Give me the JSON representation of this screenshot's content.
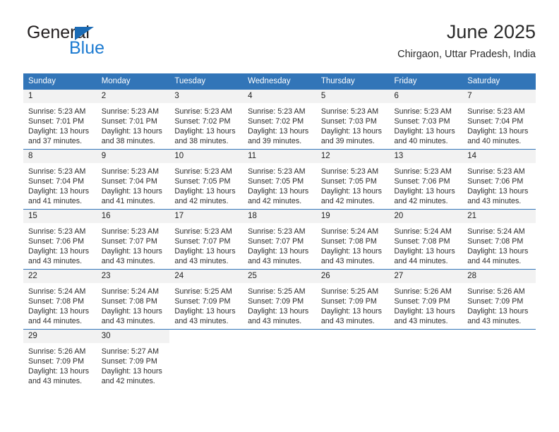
{
  "brand": {
    "name_top": "General",
    "name_bottom": "Blue",
    "accent_color": "#1b7ad1",
    "triangle_color": "#1b6bb5"
  },
  "header": {
    "title": "June 2025",
    "subtitle": "Chirgaon, Uttar Pradesh, India"
  },
  "theme": {
    "header_blue": "#3275b8",
    "daynum_bg": "#f2f2f2",
    "text": "#2b2b2b"
  },
  "weekdays": [
    "Sunday",
    "Monday",
    "Tuesday",
    "Wednesday",
    "Thursday",
    "Friday",
    "Saturday"
  ],
  "days": [
    {
      "num": "1",
      "sunrise": "Sunrise: 5:23 AM",
      "sunset": "Sunset: 7:01 PM",
      "daylight1": "Daylight: 13 hours",
      "daylight2": "and 37 minutes."
    },
    {
      "num": "2",
      "sunrise": "Sunrise: 5:23 AM",
      "sunset": "Sunset: 7:01 PM",
      "daylight1": "Daylight: 13 hours",
      "daylight2": "and 38 minutes."
    },
    {
      "num": "3",
      "sunrise": "Sunrise: 5:23 AM",
      "sunset": "Sunset: 7:02 PM",
      "daylight1": "Daylight: 13 hours",
      "daylight2": "and 38 minutes."
    },
    {
      "num": "4",
      "sunrise": "Sunrise: 5:23 AM",
      "sunset": "Sunset: 7:02 PM",
      "daylight1": "Daylight: 13 hours",
      "daylight2": "and 39 minutes."
    },
    {
      "num": "5",
      "sunrise": "Sunrise: 5:23 AM",
      "sunset": "Sunset: 7:03 PM",
      "daylight1": "Daylight: 13 hours",
      "daylight2": "and 39 minutes."
    },
    {
      "num": "6",
      "sunrise": "Sunrise: 5:23 AM",
      "sunset": "Sunset: 7:03 PM",
      "daylight1": "Daylight: 13 hours",
      "daylight2": "and 40 minutes."
    },
    {
      "num": "7",
      "sunrise": "Sunrise: 5:23 AM",
      "sunset": "Sunset: 7:04 PM",
      "daylight1": "Daylight: 13 hours",
      "daylight2": "and 40 minutes."
    },
    {
      "num": "8",
      "sunrise": "Sunrise: 5:23 AM",
      "sunset": "Sunset: 7:04 PM",
      "daylight1": "Daylight: 13 hours",
      "daylight2": "and 41 minutes."
    },
    {
      "num": "9",
      "sunrise": "Sunrise: 5:23 AM",
      "sunset": "Sunset: 7:04 PM",
      "daylight1": "Daylight: 13 hours",
      "daylight2": "and 41 minutes."
    },
    {
      "num": "10",
      "sunrise": "Sunrise: 5:23 AM",
      "sunset": "Sunset: 7:05 PM",
      "daylight1": "Daylight: 13 hours",
      "daylight2": "and 42 minutes."
    },
    {
      "num": "11",
      "sunrise": "Sunrise: 5:23 AM",
      "sunset": "Sunset: 7:05 PM",
      "daylight1": "Daylight: 13 hours",
      "daylight2": "and 42 minutes."
    },
    {
      "num": "12",
      "sunrise": "Sunrise: 5:23 AM",
      "sunset": "Sunset: 7:05 PM",
      "daylight1": "Daylight: 13 hours",
      "daylight2": "and 42 minutes."
    },
    {
      "num": "13",
      "sunrise": "Sunrise: 5:23 AM",
      "sunset": "Sunset: 7:06 PM",
      "daylight1": "Daylight: 13 hours",
      "daylight2": "and 42 minutes."
    },
    {
      "num": "14",
      "sunrise": "Sunrise: 5:23 AM",
      "sunset": "Sunset: 7:06 PM",
      "daylight1": "Daylight: 13 hours",
      "daylight2": "and 43 minutes."
    },
    {
      "num": "15",
      "sunrise": "Sunrise: 5:23 AM",
      "sunset": "Sunset: 7:06 PM",
      "daylight1": "Daylight: 13 hours",
      "daylight2": "and 43 minutes."
    },
    {
      "num": "16",
      "sunrise": "Sunrise: 5:23 AM",
      "sunset": "Sunset: 7:07 PM",
      "daylight1": "Daylight: 13 hours",
      "daylight2": "and 43 minutes."
    },
    {
      "num": "17",
      "sunrise": "Sunrise: 5:23 AM",
      "sunset": "Sunset: 7:07 PM",
      "daylight1": "Daylight: 13 hours",
      "daylight2": "and 43 minutes."
    },
    {
      "num": "18",
      "sunrise": "Sunrise: 5:23 AM",
      "sunset": "Sunset: 7:07 PM",
      "daylight1": "Daylight: 13 hours",
      "daylight2": "and 43 minutes."
    },
    {
      "num": "19",
      "sunrise": "Sunrise: 5:24 AM",
      "sunset": "Sunset: 7:08 PM",
      "daylight1": "Daylight: 13 hours",
      "daylight2": "and 43 minutes."
    },
    {
      "num": "20",
      "sunrise": "Sunrise: 5:24 AM",
      "sunset": "Sunset: 7:08 PM",
      "daylight1": "Daylight: 13 hours",
      "daylight2": "and 44 minutes."
    },
    {
      "num": "21",
      "sunrise": "Sunrise: 5:24 AM",
      "sunset": "Sunset: 7:08 PM",
      "daylight1": "Daylight: 13 hours",
      "daylight2": "and 44 minutes."
    },
    {
      "num": "22",
      "sunrise": "Sunrise: 5:24 AM",
      "sunset": "Sunset: 7:08 PM",
      "daylight1": "Daylight: 13 hours",
      "daylight2": "and 44 minutes."
    },
    {
      "num": "23",
      "sunrise": "Sunrise: 5:24 AM",
      "sunset": "Sunset: 7:08 PM",
      "daylight1": "Daylight: 13 hours",
      "daylight2": "and 43 minutes."
    },
    {
      "num": "24",
      "sunrise": "Sunrise: 5:25 AM",
      "sunset": "Sunset: 7:09 PM",
      "daylight1": "Daylight: 13 hours",
      "daylight2": "and 43 minutes."
    },
    {
      "num": "25",
      "sunrise": "Sunrise: 5:25 AM",
      "sunset": "Sunset: 7:09 PM",
      "daylight1": "Daylight: 13 hours",
      "daylight2": "and 43 minutes."
    },
    {
      "num": "26",
      "sunrise": "Sunrise: 5:25 AM",
      "sunset": "Sunset: 7:09 PM",
      "daylight1": "Daylight: 13 hours",
      "daylight2": "and 43 minutes."
    },
    {
      "num": "27",
      "sunrise": "Sunrise: 5:26 AM",
      "sunset": "Sunset: 7:09 PM",
      "daylight1": "Daylight: 13 hours",
      "daylight2": "and 43 minutes."
    },
    {
      "num": "28",
      "sunrise": "Sunrise: 5:26 AM",
      "sunset": "Sunset: 7:09 PM",
      "daylight1": "Daylight: 13 hours",
      "daylight2": "and 43 minutes."
    },
    {
      "num": "29",
      "sunrise": "Sunrise: 5:26 AM",
      "sunset": "Sunset: 7:09 PM",
      "daylight1": "Daylight: 13 hours",
      "daylight2": "and 43 minutes."
    },
    {
      "num": "30",
      "sunrise": "Sunrise: 5:27 AM",
      "sunset": "Sunset: 7:09 PM",
      "daylight1": "Daylight: 13 hours",
      "daylight2": "and 42 minutes."
    }
  ],
  "grid": {
    "leading_blanks": 0,
    "weeks": 5
  }
}
